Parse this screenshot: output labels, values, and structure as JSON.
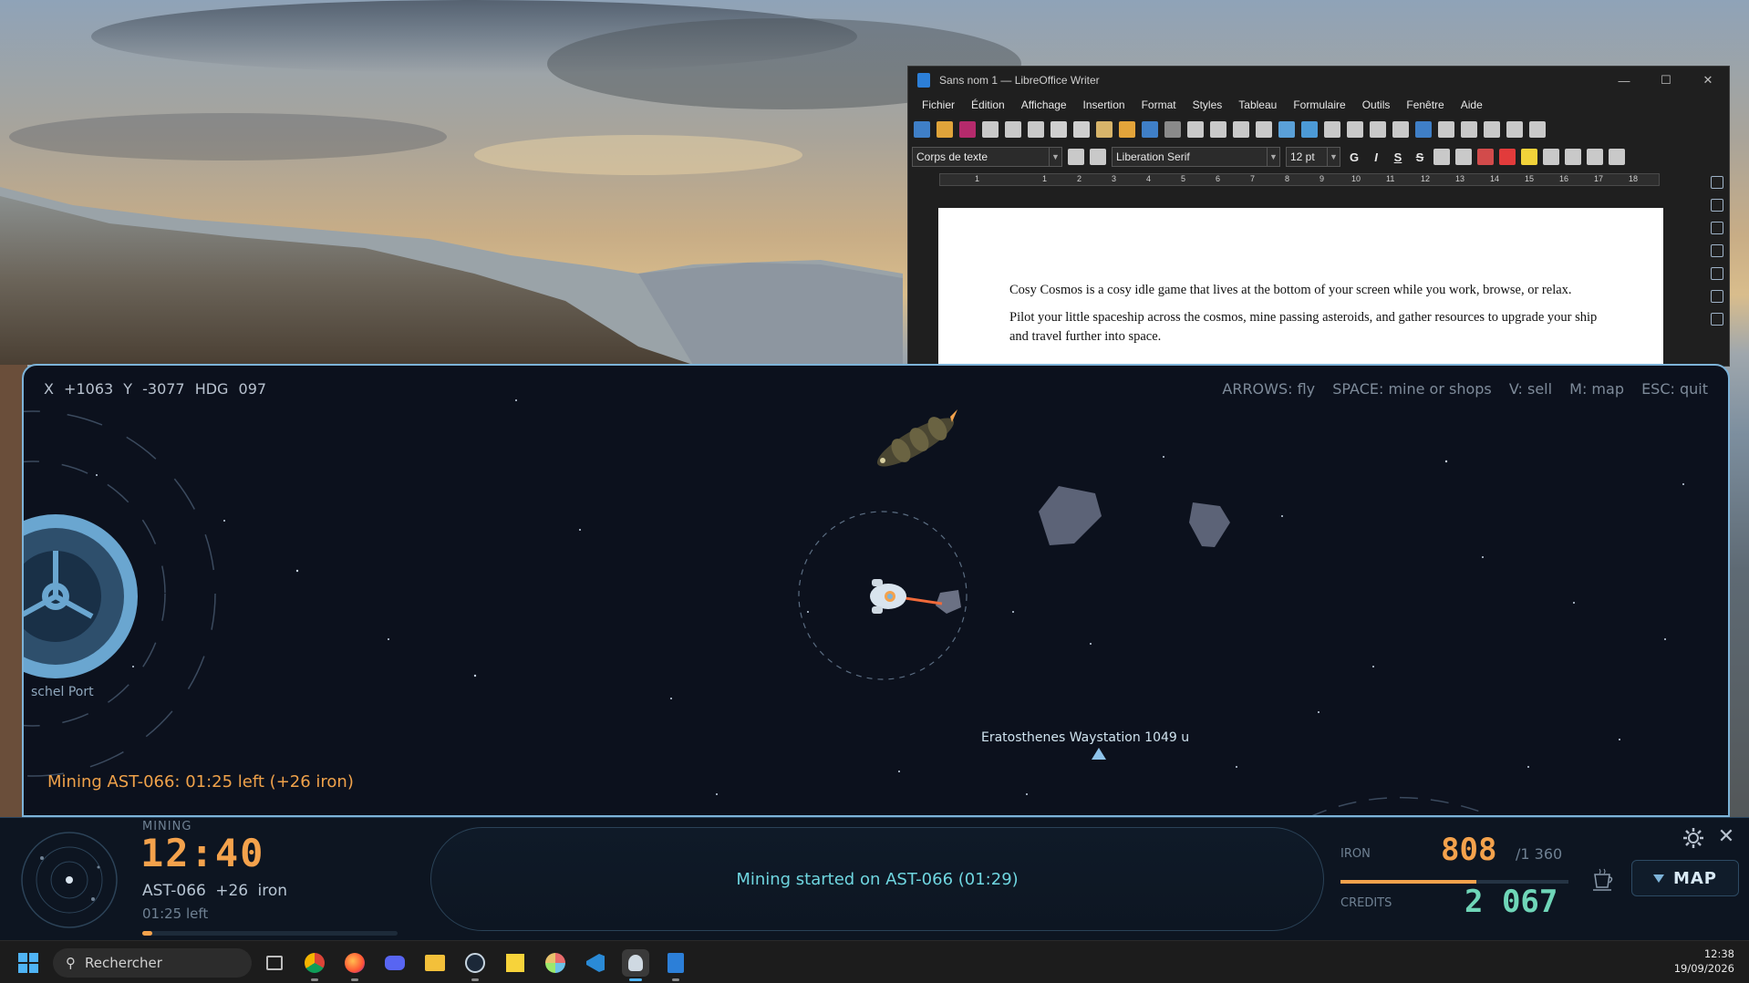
{
  "writer": {
    "title": "Sans nom 1 — LibreOffice Writer",
    "menus": [
      "Fichier",
      "Édition",
      "Affichage",
      "Insertion",
      "Format",
      "Styles",
      "Tableau",
      "Formulaire",
      "Outils",
      "Fenêtre",
      "Aide"
    ],
    "paragraph_style": "Corps de texte",
    "font_name": "Liberation Serif",
    "font_size": "12 pt",
    "format_buttons": [
      "G",
      "I",
      "S",
      "S"
    ],
    "ruler_numbers": [
      "1",
      "1",
      "2",
      "3",
      "4",
      "5",
      "6",
      "7",
      "8",
      "9",
      "10",
      "11",
      "12",
      "13",
      "14",
      "15",
      "16",
      "17",
      "18"
    ],
    "paragraphs": [
      "Cosy Cosmos is a cosy idle game that lives at the bottom of your screen while you work, browse, or relax.",
      "Pilot your little spaceship across the cosmos, mine passing asteroids, and gather resources to upgrade your ship and travel further into space."
    ]
  },
  "game": {
    "coords": "X +1063   Y -3077   HDG 097",
    "keys": [
      "ARROWS: fly",
      "SPACE: mine or shops",
      "V: sell",
      "M: map",
      "ESC: quit"
    ],
    "port_label": "schel Port",
    "station_label": "Eratosthenes Waystation  1049 u",
    "mining_message": "Mining AST-066: 01:25 left  (+26 iron)"
  },
  "hud": {
    "mode": "MINING",
    "timer": "12:40",
    "target": "AST-066  +26 iron",
    "time_left": "01:25 left",
    "progress": 0.04,
    "log": "Mining started on AST-066 (01:29)",
    "iron_label": "IRON",
    "iron_value": "808",
    "iron_cap": "/1 360",
    "iron_fraction": 0.594,
    "credits_label": "CREDITS",
    "credits_value": "2 067",
    "map_label": "MAP",
    "colors": {
      "accent": "#f4a24c",
      "teal": "#6fd6e0",
      "credits": "#6fd6b8",
      "frame": "#7db3d8"
    }
  },
  "taskbar": {
    "search_placeholder": "Rechercher",
    "apps": [
      "task-view",
      "chrome",
      "firefox",
      "discord",
      "file-explorer",
      "steam",
      "sticky-notes",
      "app-flower",
      "vscode",
      "cosy-cosmos",
      "libreoffice-writer"
    ],
    "time": "12:38",
    "date": "19/09/2026"
  }
}
